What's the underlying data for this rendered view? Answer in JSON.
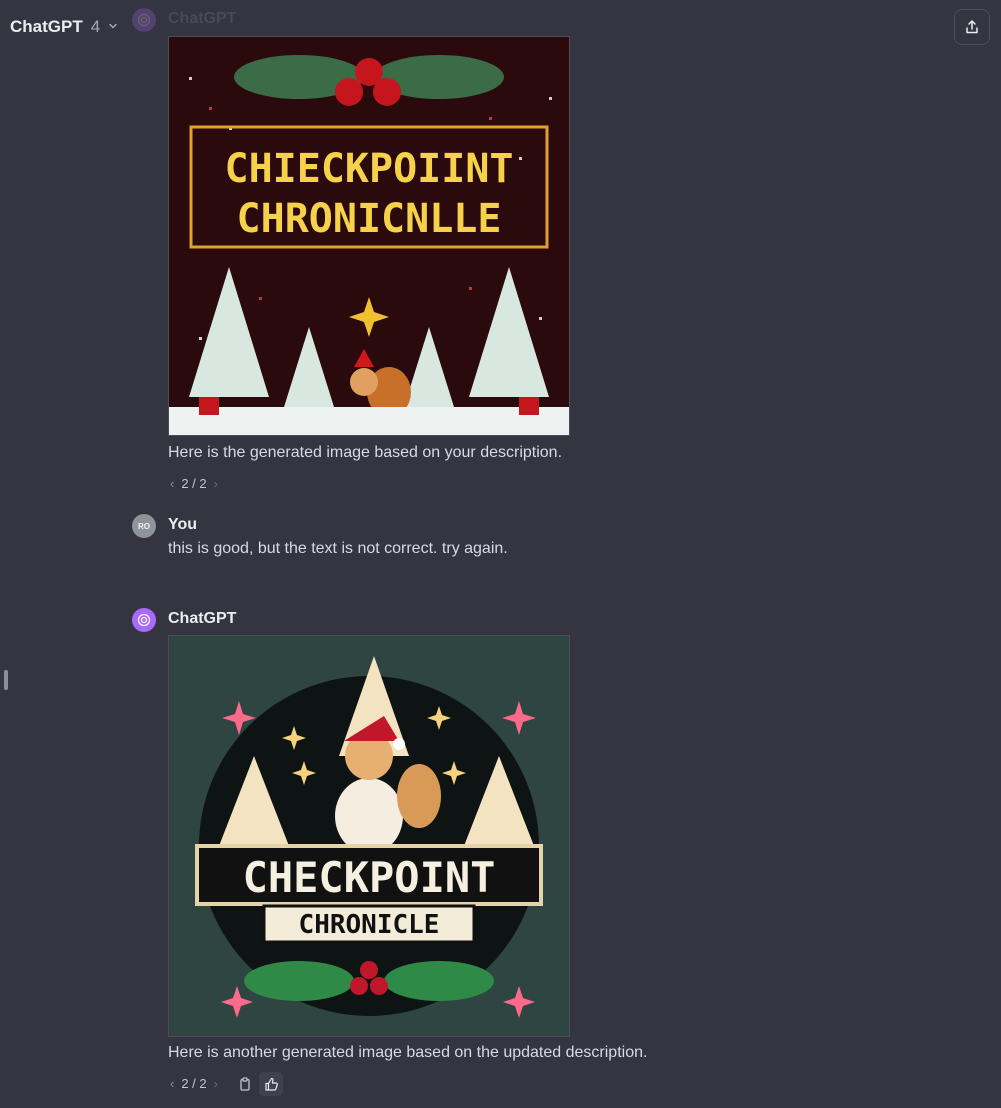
{
  "header": {
    "model_name": "ChatGPT",
    "model_version": "4"
  },
  "icons": {
    "model_chevron": "chevron-down-icon",
    "share": "share-icon",
    "assistant_avatar": "openai-logo-icon",
    "copy": "clipboard-icon",
    "feedback": "thumbs-up-icon"
  },
  "colors": {
    "background": "#343541",
    "assistant_avatar": "#ab68ff",
    "user_avatar": "#8d949a"
  },
  "messages": [
    {
      "author": "ChatGPT",
      "image_text_lines": [
        "CHIECKPOIINT",
        "CHRONICNLLE"
      ],
      "text": "Here is the generated image based on your description.",
      "pager": {
        "prev": "‹",
        "label": "2 / 2",
        "next": "›"
      }
    },
    {
      "author": "You",
      "avatar_initials": "RO",
      "text": "this is good, but the text is not correct. try again."
    },
    {
      "author": "ChatGPT",
      "image_text_lines": [
        "CHECKPOINT",
        "CHRONICLE"
      ],
      "text": "Here is another generated image based on the updated description.",
      "pager": {
        "prev": "‹",
        "label": "2 / 2",
        "next": "›"
      }
    }
  ]
}
